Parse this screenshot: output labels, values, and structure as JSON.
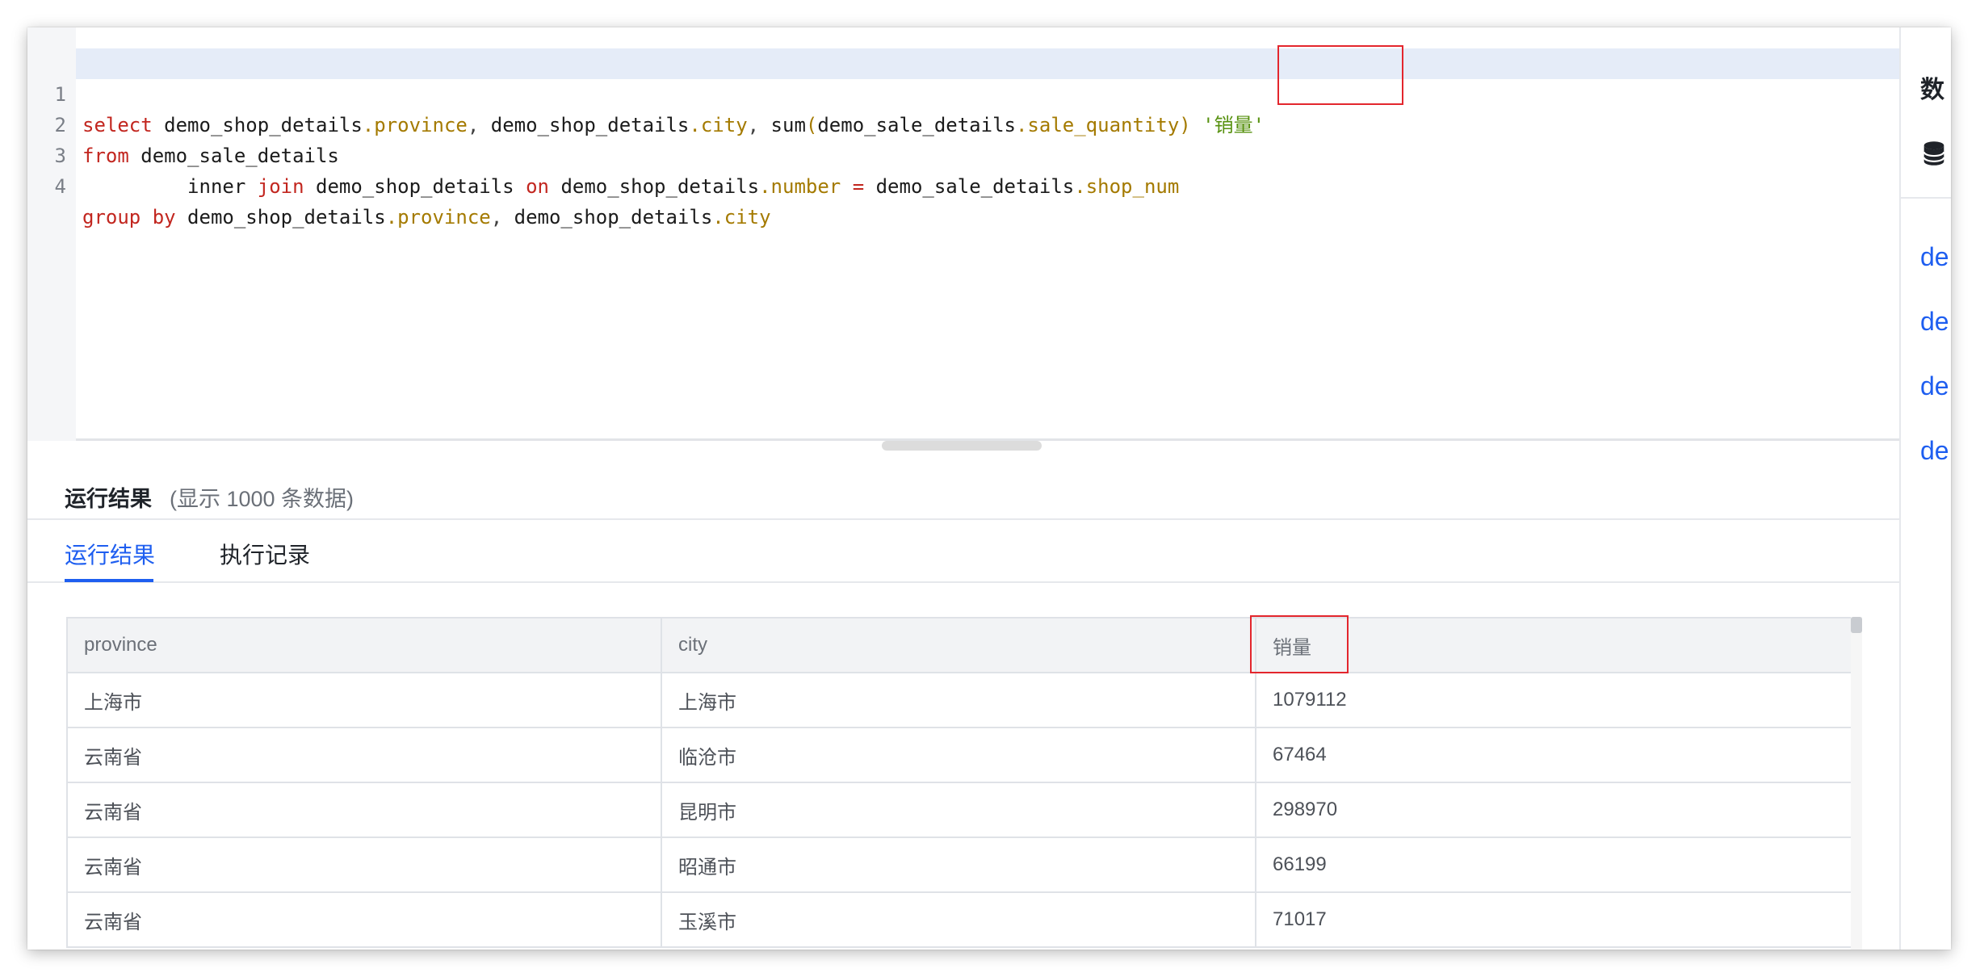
{
  "editor": {
    "lines": [
      {
        "number": "1",
        "tokens": [
          {
            "t": "select",
            "c": "kw"
          },
          {
            "t": " demo_shop_details",
            "c": "id"
          },
          {
            "t": ".province",
            "c": "fld"
          },
          {
            "t": ",",
            "c": "pn"
          },
          {
            "t": " demo_shop_details",
            "c": "id"
          },
          {
            "t": ".city",
            "c": "fld"
          },
          {
            "t": ",",
            "c": "pn"
          },
          {
            "t": " sum",
            "c": "id"
          },
          {
            "t": "(",
            "c": "fld"
          },
          {
            "t": "demo_sale_details",
            "c": "id"
          },
          {
            "t": ".sale_quantity",
            "c": "fld"
          },
          {
            "t": ")",
            "c": "fld"
          },
          {
            "t": " '销量'",
            "c": "str"
          }
        ]
      },
      {
        "number": "2",
        "tokens": [
          {
            "t": "from",
            "c": "kw"
          },
          {
            "t": " demo_sale_details",
            "c": "id"
          }
        ]
      },
      {
        "number": "3",
        "tokens": [
          {
            "t": "         inner ",
            "c": "id"
          },
          {
            "t": "join",
            "c": "kw"
          },
          {
            "t": " demo_shop_details ",
            "c": "id"
          },
          {
            "t": "on",
            "c": "kw"
          },
          {
            "t": " demo_shop_details",
            "c": "id"
          },
          {
            "t": ".number",
            "c": "fld"
          },
          {
            "t": " = ",
            "c": "kw"
          },
          {
            "t": "demo_sale_details",
            "c": "id"
          },
          {
            "t": ".shop_num",
            "c": "fld"
          }
        ]
      },
      {
        "number": "4",
        "tokens": [
          {
            "t": "group by",
            "c": "kw"
          },
          {
            "t": " demo_shop_details",
            "c": "id"
          },
          {
            "t": ".province",
            "c": "fld"
          },
          {
            "t": ",",
            "c": "pn"
          },
          {
            "t": " demo_shop_details",
            "c": "id"
          },
          {
            "t": ".city",
            "c": "fld"
          }
        ]
      }
    ]
  },
  "result": {
    "title": "运行结果",
    "subtitle": "(显示 1000 条数据)"
  },
  "tabs": [
    {
      "label": "运行结果",
      "active": true
    },
    {
      "label": "执行记录",
      "active": false
    }
  ],
  "table": {
    "columns": [
      "province",
      "city",
      "销量"
    ],
    "rows": [
      [
        "上海市",
        "上海市",
        "1079112"
      ],
      [
        "云南省",
        "临沧市",
        "67464"
      ],
      [
        "云南省",
        "昆明市",
        "298970"
      ],
      [
        "云南省",
        "昭通市",
        "66199"
      ],
      [
        "云南省",
        "玉溪市",
        "71017"
      ]
    ]
  },
  "right_panel": {
    "title": "数",
    "icon": "database-icon",
    "links": [
      "de",
      "de",
      "de",
      "de"
    ]
  },
  "colors": {
    "keyword": "#c2261f",
    "field": "#a47a00",
    "string": "#57910f",
    "accent": "#1e5ef0",
    "highlight_box": "#e3262d"
  }
}
